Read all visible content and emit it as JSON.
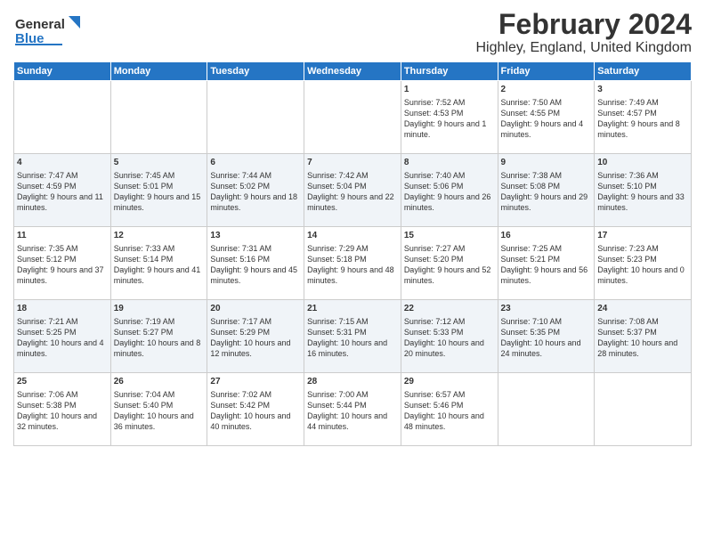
{
  "header": {
    "logo_general": "General",
    "logo_blue": "Blue",
    "title": "February 2024",
    "subtitle": "Highley, England, United Kingdom"
  },
  "weekdays": [
    "Sunday",
    "Monday",
    "Tuesday",
    "Wednesday",
    "Thursday",
    "Friday",
    "Saturday"
  ],
  "weeks": [
    [
      {
        "day": "",
        "info": ""
      },
      {
        "day": "",
        "info": ""
      },
      {
        "day": "",
        "info": ""
      },
      {
        "day": "",
        "info": ""
      },
      {
        "day": "1",
        "info": "Sunrise: 7:52 AM\nSunset: 4:53 PM\nDaylight: 9 hours and 1 minute."
      },
      {
        "day": "2",
        "info": "Sunrise: 7:50 AM\nSunset: 4:55 PM\nDaylight: 9 hours and 4 minutes."
      },
      {
        "day": "3",
        "info": "Sunrise: 7:49 AM\nSunset: 4:57 PM\nDaylight: 9 hours and 8 minutes."
      }
    ],
    [
      {
        "day": "4",
        "info": "Sunrise: 7:47 AM\nSunset: 4:59 PM\nDaylight: 9 hours and 11 minutes."
      },
      {
        "day": "5",
        "info": "Sunrise: 7:45 AM\nSunset: 5:01 PM\nDaylight: 9 hours and 15 minutes."
      },
      {
        "day": "6",
        "info": "Sunrise: 7:44 AM\nSunset: 5:02 PM\nDaylight: 9 hours and 18 minutes."
      },
      {
        "day": "7",
        "info": "Sunrise: 7:42 AM\nSunset: 5:04 PM\nDaylight: 9 hours and 22 minutes."
      },
      {
        "day": "8",
        "info": "Sunrise: 7:40 AM\nSunset: 5:06 PM\nDaylight: 9 hours and 26 minutes."
      },
      {
        "day": "9",
        "info": "Sunrise: 7:38 AM\nSunset: 5:08 PM\nDaylight: 9 hours and 29 minutes."
      },
      {
        "day": "10",
        "info": "Sunrise: 7:36 AM\nSunset: 5:10 PM\nDaylight: 9 hours and 33 minutes."
      }
    ],
    [
      {
        "day": "11",
        "info": "Sunrise: 7:35 AM\nSunset: 5:12 PM\nDaylight: 9 hours and 37 minutes."
      },
      {
        "day": "12",
        "info": "Sunrise: 7:33 AM\nSunset: 5:14 PM\nDaylight: 9 hours and 41 minutes."
      },
      {
        "day": "13",
        "info": "Sunrise: 7:31 AM\nSunset: 5:16 PM\nDaylight: 9 hours and 45 minutes."
      },
      {
        "day": "14",
        "info": "Sunrise: 7:29 AM\nSunset: 5:18 PM\nDaylight: 9 hours and 48 minutes."
      },
      {
        "day": "15",
        "info": "Sunrise: 7:27 AM\nSunset: 5:20 PM\nDaylight: 9 hours and 52 minutes."
      },
      {
        "day": "16",
        "info": "Sunrise: 7:25 AM\nSunset: 5:21 PM\nDaylight: 9 hours and 56 minutes."
      },
      {
        "day": "17",
        "info": "Sunrise: 7:23 AM\nSunset: 5:23 PM\nDaylight: 10 hours and 0 minutes."
      }
    ],
    [
      {
        "day": "18",
        "info": "Sunrise: 7:21 AM\nSunset: 5:25 PM\nDaylight: 10 hours and 4 minutes."
      },
      {
        "day": "19",
        "info": "Sunrise: 7:19 AM\nSunset: 5:27 PM\nDaylight: 10 hours and 8 minutes."
      },
      {
        "day": "20",
        "info": "Sunrise: 7:17 AM\nSunset: 5:29 PM\nDaylight: 10 hours and 12 minutes."
      },
      {
        "day": "21",
        "info": "Sunrise: 7:15 AM\nSunset: 5:31 PM\nDaylight: 10 hours and 16 minutes."
      },
      {
        "day": "22",
        "info": "Sunrise: 7:12 AM\nSunset: 5:33 PM\nDaylight: 10 hours and 20 minutes."
      },
      {
        "day": "23",
        "info": "Sunrise: 7:10 AM\nSunset: 5:35 PM\nDaylight: 10 hours and 24 minutes."
      },
      {
        "day": "24",
        "info": "Sunrise: 7:08 AM\nSunset: 5:37 PM\nDaylight: 10 hours and 28 minutes."
      }
    ],
    [
      {
        "day": "25",
        "info": "Sunrise: 7:06 AM\nSunset: 5:38 PM\nDaylight: 10 hours and 32 minutes."
      },
      {
        "day": "26",
        "info": "Sunrise: 7:04 AM\nSunset: 5:40 PM\nDaylight: 10 hours and 36 minutes."
      },
      {
        "day": "27",
        "info": "Sunrise: 7:02 AM\nSunset: 5:42 PM\nDaylight: 10 hours and 40 minutes."
      },
      {
        "day": "28",
        "info": "Sunrise: 7:00 AM\nSunset: 5:44 PM\nDaylight: 10 hours and 44 minutes."
      },
      {
        "day": "29",
        "info": "Sunrise: 6:57 AM\nSunset: 5:46 PM\nDaylight: 10 hours and 48 minutes."
      },
      {
        "day": "",
        "info": ""
      },
      {
        "day": "",
        "info": ""
      }
    ]
  ]
}
